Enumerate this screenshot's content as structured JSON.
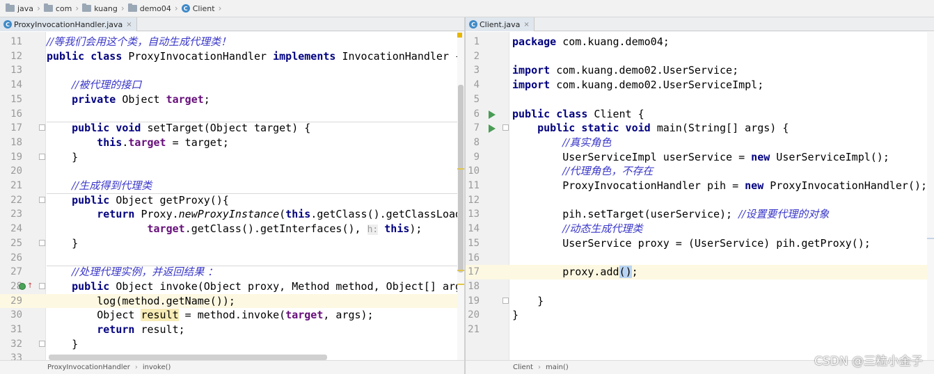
{
  "breadcrumb": [
    {
      "icon": "folder-icon",
      "label": "java"
    },
    {
      "icon": "folder-icon",
      "label": "com"
    },
    {
      "icon": "folder-icon",
      "label": "kuang"
    },
    {
      "icon": "folder-icon",
      "label": "demo04"
    },
    {
      "icon": "class-icon",
      "label": "Client"
    }
  ],
  "left_editor": {
    "tab": {
      "label": "ProxyInvocationHandler.java",
      "close": "×"
    },
    "lines": [
      {
        "num": "11",
        "segments": [
          [
            "cm",
            "//等我们会用这个类，自动生成代理类！"
          ]
        ]
      },
      {
        "num": "12",
        "segments": [
          [
            "kw",
            "public class "
          ],
          [
            "",
            "ProxyInvocationHandler "
          ],
          [
            "kw",
            "implements "
          ],
          [
            "",
            "InvocationHandler {"
          ]
        ]
      },
      {
        "num": "13",
        "segments": []
      },
      {
        "num": "14",
        "segments": [
          [
            "",
            "    "
          ],
          [
            "cm",
            "//被代理的接口"
          ]
        ]
      },
      {
        "num": "15",
        "segments": [
          [
            "",
            "    "
          ],
          [
            "kw",
            "private "
          ],
          [
            "",
            "Object "
          ],
          [
            "fd",
            "target"
          ],
          [
            "",
            ";"
          ]
        ]
      },
      {
        "num": "16",
        "segments": []
      },
      {
        "num": "17",
        "segments": [
          [
            "",
            "    "
          ],
          [
            "kw",
            "public void "
          ],
          [
            "",
            "setTarget(Object target) {"
          ]
        ]
      },
      {
        "num": "18",
        "segments": [
          [
            "",
            "        "
          ],
          [
            "kw",
            "this"
          ],
          [
            "",
            "."
          ],
          [
            "fd",
            "target"
          ],
          [
            "",
            " = target;"
          ]
        ]
      },
      {
        "num": "19",
        "segments": [
          [
            "",
            "    }"
          ]
        ]
      },
      {
        "num": "20",
        "segments": []
      },
      {
        "num": "21",
        "segments": [
          [
            "",
            "    "
          ],
          [
            "cm",
            "//生成得到代理类"
          ]
        ]
      },
      {
        "num": "22",
        "segments": [
          [
            "",
            "    "
          ],
          [
            "kw",
            "public "
          ],
          [
            "",
            "Object getProxy(){"
          ]
        ]
      },
      {
        "num": "23",
        "segments": [
          [
            "",
            "        "
          ],
          [
            "kw",
            "return "
          ],
          [
            "",
            "Proxy."
          ],
          [
            "it",
            "newProxyInstance"
          ],
          [
            "",
            "("
          ],
          [
            "kw",
            "this"
          ],
          [
            "",
            ".getClass().getClassLoader(),"
          ]
        ]
      },
      {
        "num": "24",
        "segments": [
          [
            "",
            "                "
          ],
          [
            "fd",
            "target"
          ],
          [
            "",
            ".getClass().getInterfaces(), "
          ],
          [
            "hint",
            "h:"
          ],
          [
            "",
            " "
          ],
          [
            "kw",
            "this"
          ],
          [
            "",
            ");"
          ]
        ]
      },
      {
        "num": "25",
        "segments": [
          [
            "",
            "    }"
          ]
        ]
      },
      {
        "num": "26",
        "segments": []
      },
      {
        "num": "27",
        "segments": [
          [
            "",
            "    "
          ],
          [
            "cm",
            "//处理代理实例，并返回结果 ："
          ]
        ]
      },
      {
        "num": "28",
        "segments": [
          [
            "",
            "    "
          ],
          [
            "kw",
            "public "
          ],
          [
            "",
            "Object invoke(Object proxy, Method method, Object[] args) {"
          ]
        ]
      },
      {
        "num": "29",
        "segments": [
          [
            "",
            "        log(method.getName());"
          ]
        ]
      },
      {
        "num": "30",
        "segments": [
          [
            "",
            "        Object "
          ],
          [
            "mk",
            "result"
          ],
          [
            "",
            " = method.invoke("
          ],
          [
            "fd",
            "target"
          ],
          [
            "",
            ", args);"
          ]
        ]
      },
      {
        "num": "31",
        "segments": [
          [
            "",
            "        "
          ],
          [
            "kw",
            "return "
          ],
          [
            "",
            "result;"
          ]
        ]
      },
      {
        "num": "32",
        "segments": [
          [
            "",
            "    }"
          ]
        ]
      },
      {
        "num": "33",
        "segments": []
      }
    ],
    "status": [
      "ProxyInvocationHandler",
      "invoke()"
    ]
  },
  "right_editor": {
    "tab": {
      "label": "Client.java",
      "close": "×"
    },
    "lines": [
      {
        "num": "1",
        "segments": [
          [
            "kw",
            "package "
          ],
          [
            "",
            "com.kuang.demo04;"
          ]
        ]
      },
      {
        "num": "2",
        "segments": []
      },
      {
        "num": "3",
        "segments": [
          [
            "kw",
            "import "
          ],
          [
            "",
            "com.kuang.demo02.UserService;"
          ]
        ]
      },
      {
        "num": "4",
        "segments": [
          [
            "kw",
            "import "
          ],
          [
            "",
            "com.kuang.demo02.UserServiceImpl;"
          ]
        ]
      },
      {
        "num": "5",
        "segments": []
      },
      {
        "num": "6",
        "segments": [
          [
            "kw",
            "public class "
          ],
          [
            "",
            "Client {"
          ]
        ]
      },
      {
        "num": "7",
        "segments": [
          [
            "",
            "    "
          ],
          [
            "kw",
            "public static void "
          ],
          [
            "",
            "main(String[] args) {"
          ]
        ]
      },
      {
        "num": "8",
        "segments": [
          [
            "",
            "        "
          ],
          [
            "cm",
            "//真实角色"
          ]
        ]
      },
      {
        "num": "9",
        "segments": [
          [
            "",
            "        UserServiceImpl userService = "
          ],
          [
            "kw",
            "new "
          ],
          [
            "",
            "UserServiceImpl();"
          ]
        ]
      },
      {
        "num": "10",
        "segments": [
          [
            "",
            "        "
          ],
          [
            "cm",
            "//代理角色，不存在"
          ]
        ]
      },
      {
        "num": "11",
        "segments": [
          [
            "",
            "        ProxyInvocationHandler pih = "
          ],
          [
            "kw",
            "new "
          ],
          [
            "",
            "ProxyInvocationHandler();"
          ]
        ]
      },
      {
        "num": "12",
        "segments": []
      },
      {
        "num": "13",
        "segments": [
          [
            "",
            "        pih.setTarget(userService); "
          ],
          [
            "cm",
            "//设置要代理的对象"
          ]
        ]
      },
      {
        "num": "14",
        "segments": [
          [
            "",
            "        "
          ],
          [
            "cm",
            "//动态生成代理类"
          ]
        ]
      },
      {
        "num": "15",
        "segments": [
          [
            "",
            "        UserService proxy = (UserService) pih.getProxy();"
          ]
        ]
      },
      {
        "num": "16",
        "segments": []
      },
      {
        "num": "17",
        "segments": [
          [
            "",
            "        proxy.add"
          ],
          [
            "sel",
            "("
          ],
          [
            "sel",
            ")"
          ],
          [
            "",
            ";"
          ]
        ]
      },
      {
        "num": "18",
        "segments": []
      },
      {
        "num": "19",
        "segments": [
          [
            "",
            "    }"
          ]
        ]
      },
      {
        "num": "20",
        "segments": [
          [
            "",
            "}"
          ]
        ]
      },
      {
        "num": "21",
        "segments": []
      }
    ],
    "status": [
      "Client",
      "main()"
    ]
  },
  "watermark": "CSDN @三粒小金子",
  "colors": {
    "keyword": "#000080",
    "comment": "#3a37c8",
    "field": "#660e7a",
    "current_line": "#fdf8e1",
    "run_icon": "#499c54"
  }
}
